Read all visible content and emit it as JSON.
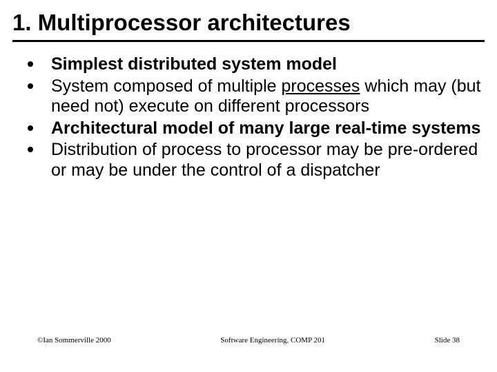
{
  "title": "1. Multiprocessor architectures",
  "bullets": {
    "b1_bold": "Simplest distributed system model",
    "b2_plain_a": "System composed of multiple ",
    "b2_u": "processes",
    "b2_plain_b": " which may (but need not) execute on different processors",
    "b3_bold": "Architectural model of many large real-time systems",
    "b4_plain": "Distribution of process to processor may be pre-ordered or may be under the control of a dispatcher"
  },
  "footer": {
    "left": "©Ian Sommerville 2000",
    "center": "Software Engineering, COMP 201",
    "right": "Slide 38"
  }
}
